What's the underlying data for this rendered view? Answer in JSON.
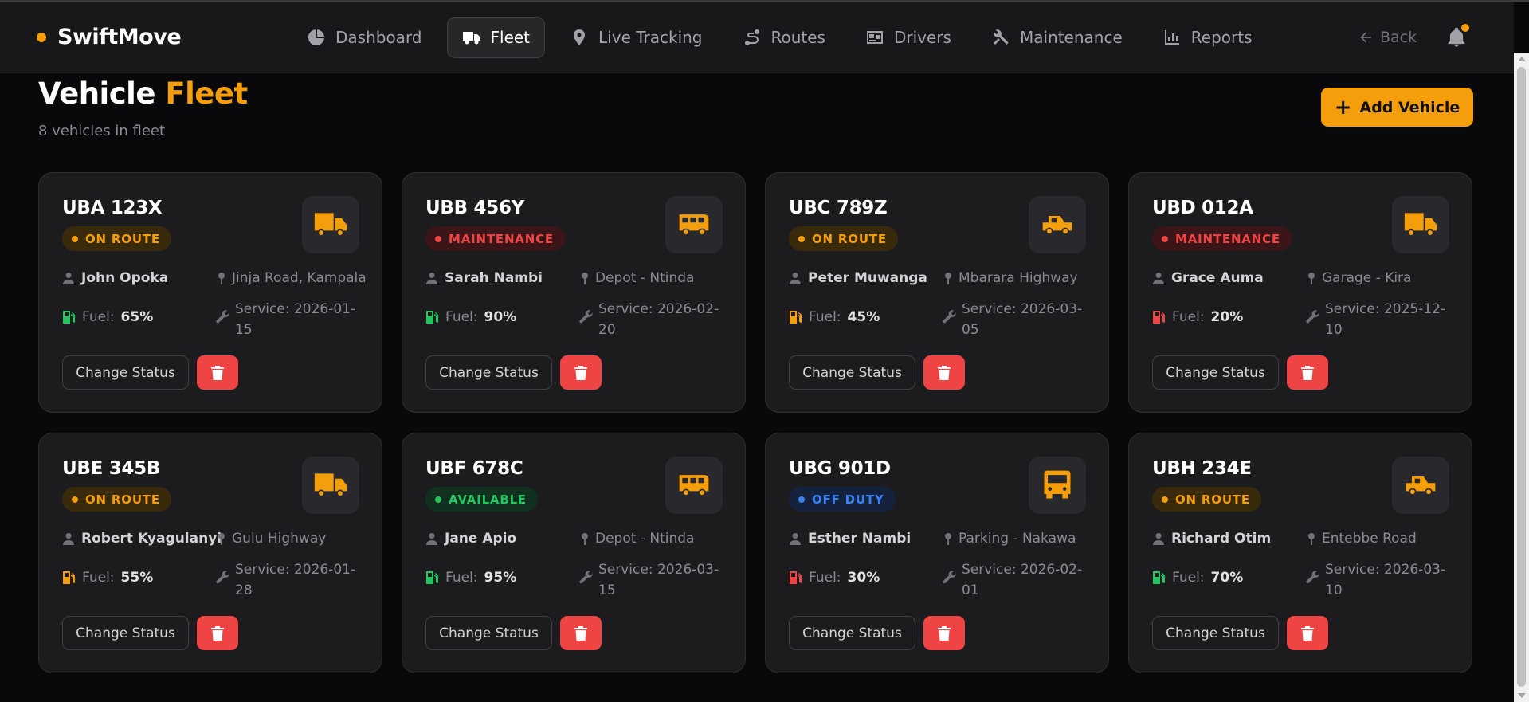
{
  "app": {
    "brand": "SwiftMove"
  },
  "colors": {
    "accent": "#f59e0b",
    "on_route": "#f59e0b",
    "maintenance": "#ef4444",
    "available": "#22c55e",
    "off_duty": "#3b82f6"
  },
  "nav": {
    "items": [
      {
        "label": "Dashboard",
        "icon": "pie-chart-icon",
        "active": false
      },
      {
        "label": "Fleet",
        "icon": "truck-icon",
        "active": true
      },
      {
        "label": "Live Tracking",
        "icon": "map-pin-icon",
        "active": false
      },
      {
        "label": "Routes",
        "icon": "route-icon",
        "active": false
      },
      {
        "label": "Drivers",
        "icon": "id-card-icon",
        "active": false
      },
      {
        "label": "Maintenance",
        "icon": "tools-icon",
        "active": false
      },
      {
        "label": "Reports",
        "icon": "bar-chart-icon",
        "active": false
      }
    ],
    "back_label": "Back"
  },
  "header": {
    "title_main": "Vehicle",
    "title_accent": "Fleet",
    "subtitle": "8 vehicles in fleet",
    "add_button": "Add Vehicle"
  },
  "labels": {
    "fuel": "Fuel:",
    "change_status": "Change Status"
  },
  "vehicles": [
    {
      "plate": "UBA 123X",
      "status": "ON ROUTE",
      "status_kind": "on_route",
      "type_icon": "truck-icon",
      "driver": "John Opoka",
      "location": "Jinja Road, Kampala",
      "fuel": "65%",
      "fuel_level": "high",
      "service": "Service: 2026-01-15"
    },
    {
      "plate": "UBB 456Y",
      "status": "MAINTENANCE",
      "status_kind": "maintenance",
      "type_icon": "van-icon",
      "driver": "Sarah Nambi",
      "location": "Depot - Ntinda",
      "fuel": "90%",
      "fuel_level": "high",
      "service": "Service: 2026-02-20"
    },
    {
      "plate": "UBC 789Z",
      "status": "ON ROUTE",
      "status_kind": "on_route",
      "type_icon": "pickup-icon",
      "driver": "Peter Muwanga",
      "location": "Mbarara Highway",
      "fuel": "45%",
      "fuel_level": "mid",
      "service": "Service: 2026-03-05"
    },
    {
      "plate": "UBD 012A",
      "status": "MAINTENANCE",
      "status_kind": "maintenance",
      "type_icon": "truck-icon",
      "driver": "Grace Auma",
      "location": "Garage - Kira",
      "fuel": "20%",
      "fuel_level": "low",
      "service": "Service: 2025-12-10"
    },
    {
      "plate": "UBE 345B",
      "status": "ON ROUTE",
      "status_kind": "on_route",
      "type_icon": "truck-icon",
      "driver": "Robert Kyagulanyi",
      "location": "Gulu Highway",
      "fuel": "55%",
      "fuel_level": "mid",
      "service": "Service: 2026-01-28"
    },
    {
      "plate": "UBF 678C",
      "status": "AVAILABLE",
      "status_kind": "available",
      "type_icon": "van-icon",
      "driver": "Jane Apio",
      "location": "Depot - Ntinda",
      "fuel": "95%",
      "fuel_level": "high",
      "service": "Service: 2026-03-15"
    },
    {
      "plate": "UBG 901D",
      "status": "OFF DUTY",
      "status_kind": "off_duty",
      "type_icon": "bus-icon",
      "driver": "Esther Nambi",
      "location": "Parking - Nakawa",
      "fuel": "30%",
      "fuel_level": "low",
      "service": "Service: 2026-02-01"
    },
    {
      "plate": "UBH 234E",
      "status": "ON ROUTE",
      "status_kind": "on_route",
      "type_icon": "pickup-icon",
      "driver": "Richard Otim",
      "location": "Entebbe Road",
      "fuel": "70%",
      "fuel_level": "high",
      "service": "Service: 2026-03-10"
    }
  ]
}
